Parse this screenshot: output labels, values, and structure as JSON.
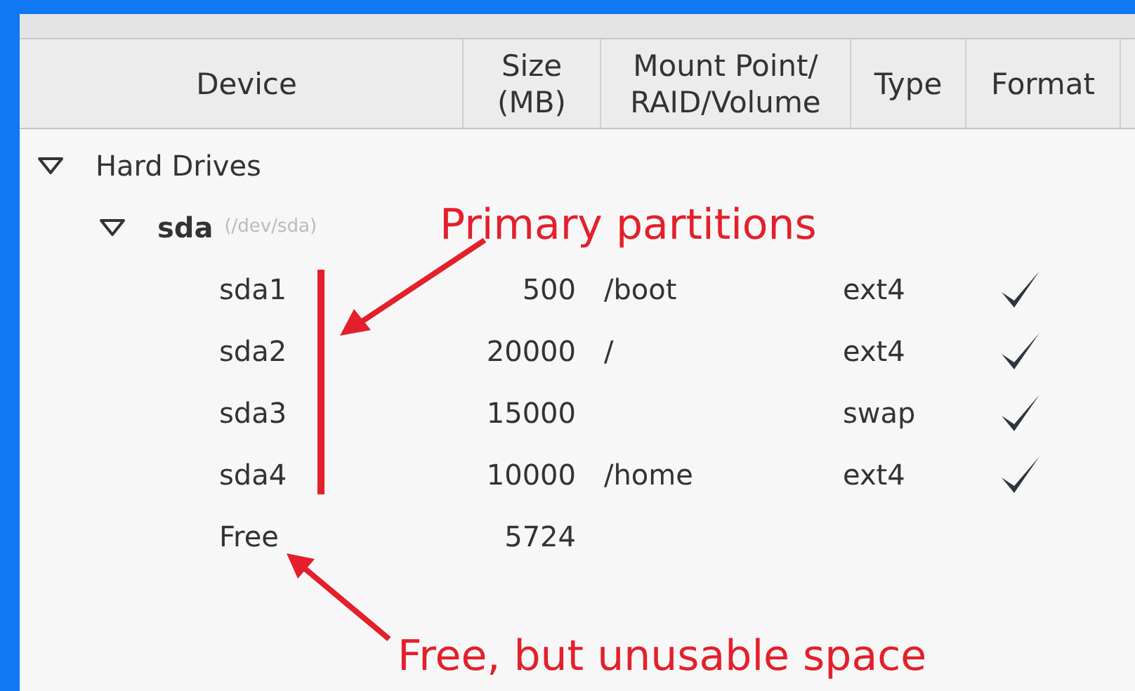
{
  "table": {
    "columns": [
      {
        "label": "Device"
      },
      {
        "label": "Size\n(MB)"
      },
      {
        "label": "Mount Point/\nRAID/Volume"
      },
      {
        "label": "Type"
      },
      {
        "label": "Format"
      }
    ],
    "rows": [
      {
        "name": "Hard Drives",
        "expanded": true,
        "children": [
          {
            "name": "sda",
            "path": "(/dev/sda)",
            "expanded": true,
            "children": [
              {
                "name": "sda1",
                "size": "500",
                "mount": "/boot",
                "type": "ext4",
                "format": true
              },
              {
                "name": "sda2",
                "size": "20000",
                "mount": "/",
                "type": "ext4",
                "format": true
              },
              {
                "name": "sda3",
                "size": "15000",
                "type": "swap",
                "format": true
              },
              {
                "name": "sda4",
                "size": "10000",
                "mount": "/home",
                "type": "ext4",
                "format": true
              },
              {
                "name": "Free",
                "size": "5724",
                "format": false
              }
            ]
          }
        ]
      }
    ]
  },
  "annotations": [
    {
      "kind": "primary",
      "text": "Primary partitions"
    },
    {
      "kind": "free",
      "text": "Free, but unusable space"
    }
  ]
}
